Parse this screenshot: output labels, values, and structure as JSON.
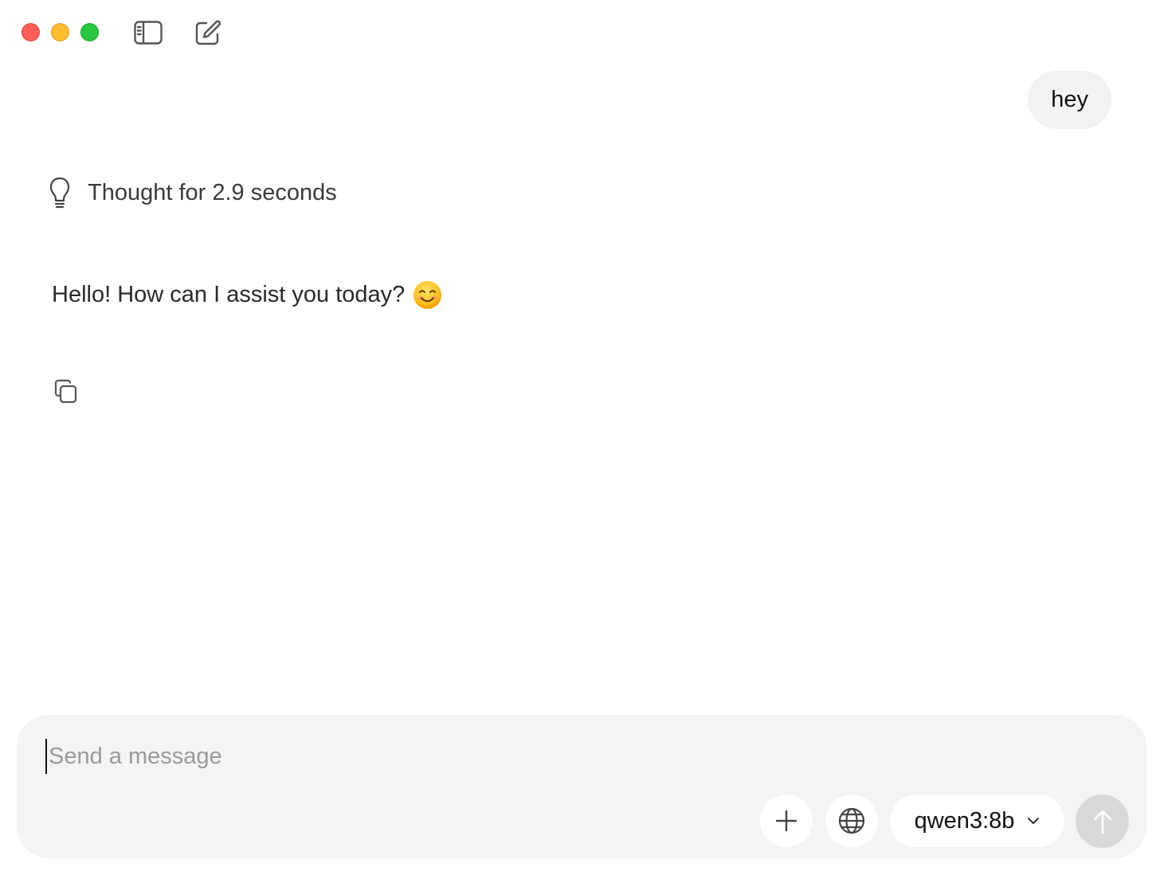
{
  "window": {
    "controls": [
      "close",
      "minimize",
      "zoom"
    ]
  },
  "toolbar": {
    "sidebar_icon": "sidebar-toggle-icon",
    "compose_icon": "new-chat-icon"
  },
  "conversation": {
    "user_message": "hey",
    "thought": {
      "icon": "lightbulb-icon",
      "label": "Thought for 2.9 seconds"
    },
    "assistant_message": "Hello! How can I assist you today?",
    "assistant_emoji": "😊",
    "copy_icon": "copy-icon"
  },
  "composer": {
    "placeholder": "Send a message",
    "value": "",
    "add_icon": "plus-icon",
    "web_icon": "globe-icon",
    "model": "qwen3:8b",
    "send_icon": "arrow-up-icon"
  },
  "colors": {
    "close": "#ff5f57",
    "minimize": "#febc2e",
    "zoom": "#28c840",
    "bubble_bg": "#f2f2f2",
    "composer_bg": "#f4f4f4",
    "send_disabled": "#d9d9d9"
  }
}
